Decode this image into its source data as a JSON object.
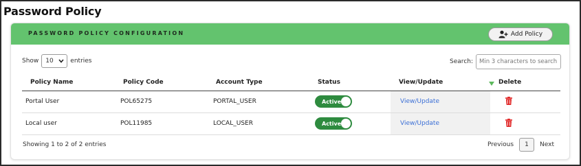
{
  "page": {
    "title": "Password Policy"
  },
  "card": {
    "header_title": "PASSWORD POLICY CONFIGURATION",
    "add_button_label": "Add Policy",
    "add_button_icon": "add-user-icon",
    "header_color": "#63c36e"
  },
  "controls": {
    "show_label": "Show",
    "entries_value": "10",
    "entries_label": "entries",
    "search_label": "Search:",
    "search_placeholder": "Min 3 characters to search"
  },
  "table": {
    "headers": [
      "Policy Name",
      "Policy Code",
      "Account Type",
      "Status",
      "View/Update",
      "Delete"
    ],
    "rows": [
      {
        "name": "Portal User",
        "code": "POL65275",
        "account_type": "PORTAL_USER",
        "status": "Active",
        "view": "View/Update",
        "delete_icon": "trash-icon"
      },
      {
        "name": "Local user",
        "code": "POL11985",
        "account_type": "LOCAL_USER",
        "status": "Active",
        "view": "View/Update",
        "delete_icon": "trash-icon"
      }
    ]
  },
  "footer": {
    "info": "Showing 1 to 2 of 2 entries",
    "previous": "Previous",
    "current_page": "1",
    "next": "Next"
  }
}
